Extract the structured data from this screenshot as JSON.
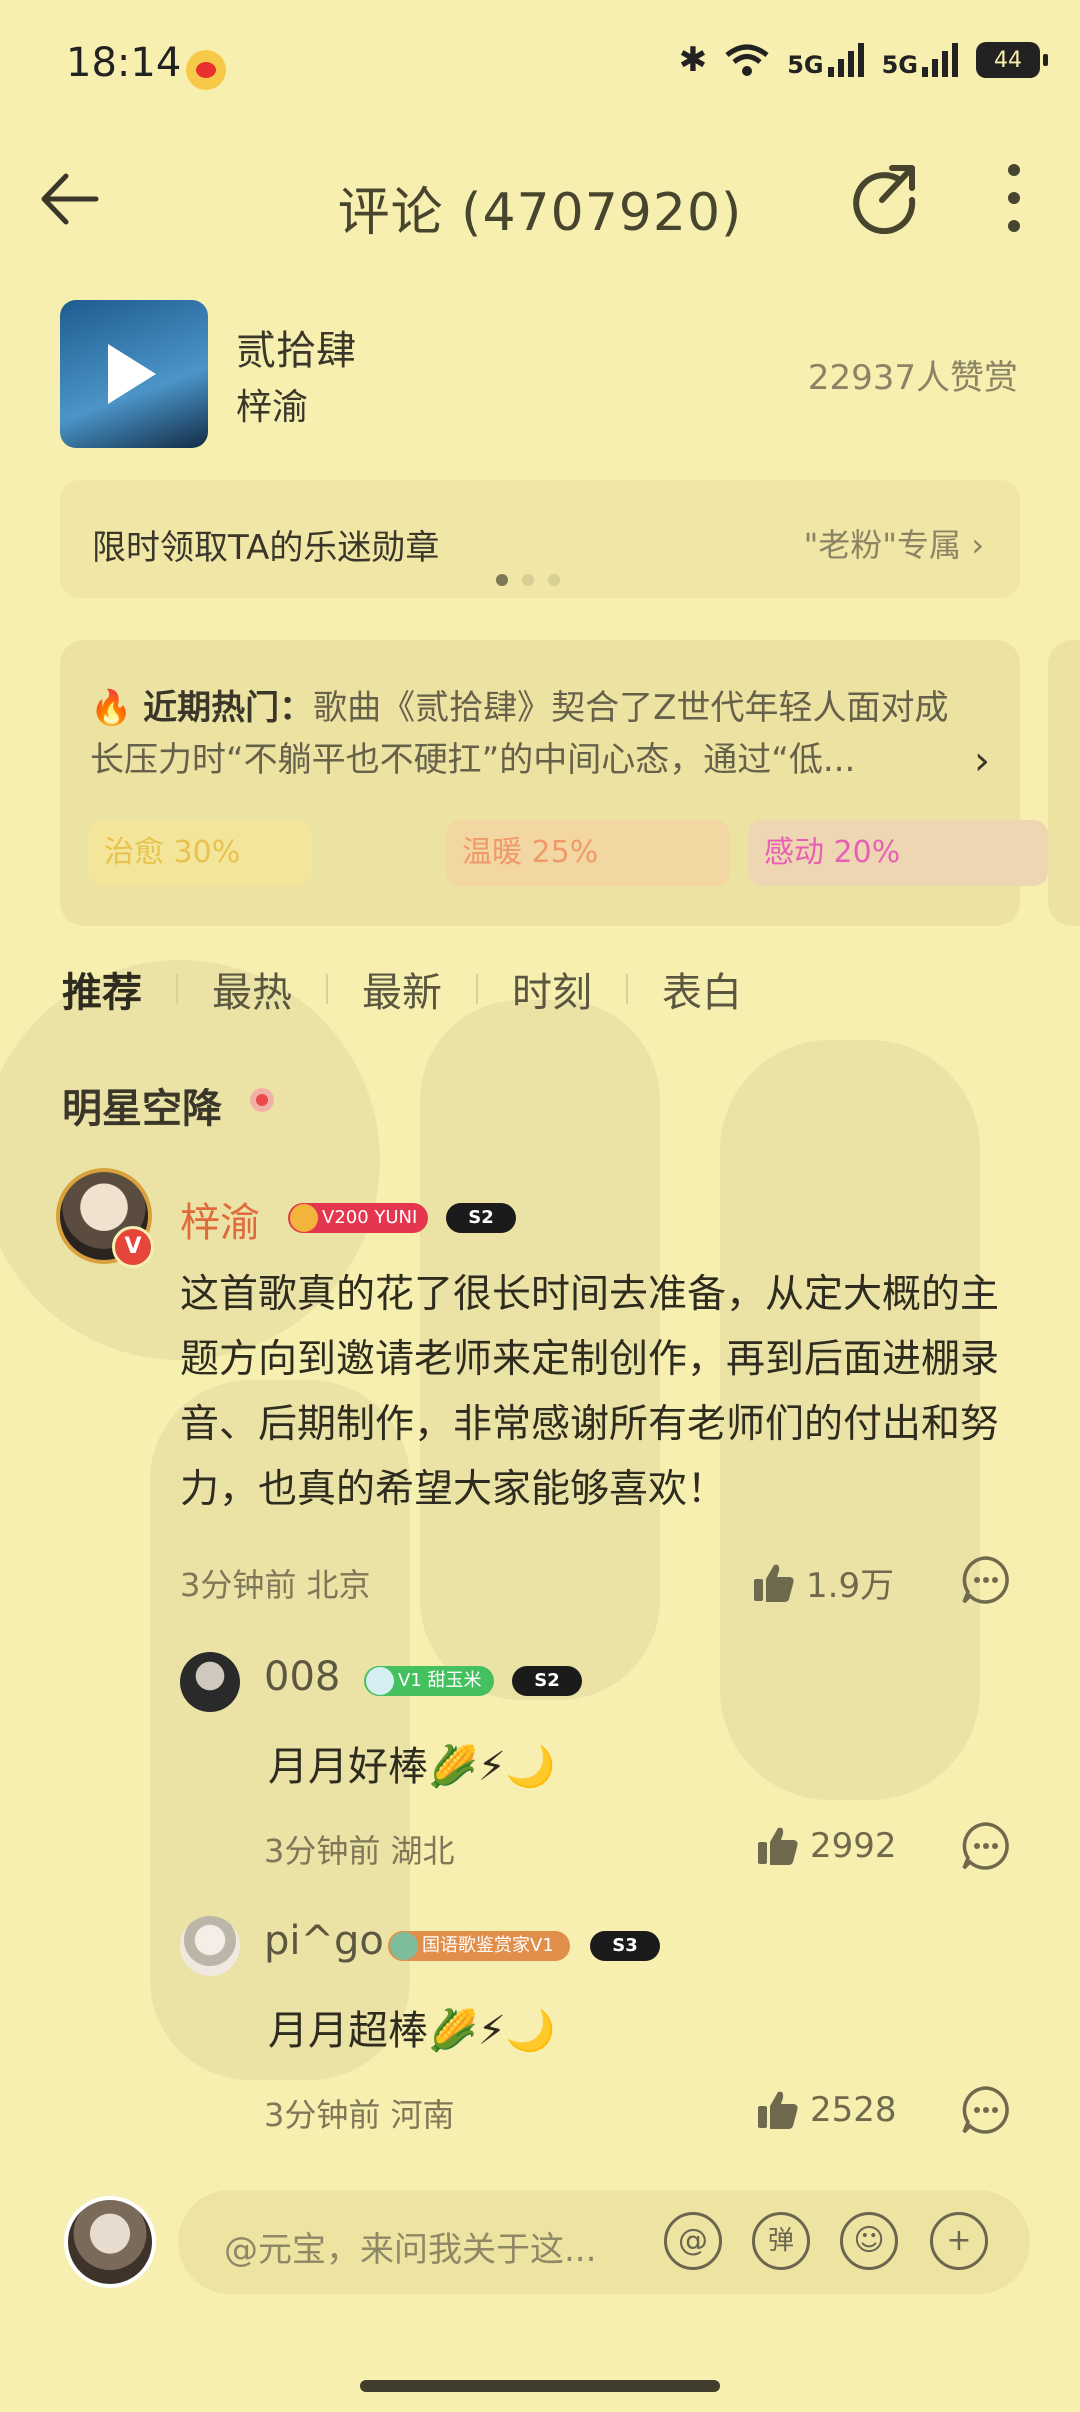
{
  "status_bar": {
    "time": "18:14",
    "signal1": "5G",
    "signal2": "5G",
    "battery": "44"
  },
  "header": {
    "title": "评论 (4707920)",
    "back_icon": "arrow-left-icon",
    "share_icon": "share-icon",
    "more_icon": "more-vertical-icon"
  },
  "song": {
    "title": "贰拾肆",
    "artist": "梓渝",
    "praise_count": "22937人赞赏"
  },
  "badge_banner": {
    "text": "限时领取TA的乐迷勋章",
    "action": "\"老粉\"专属 ›"
  },
  "hot_card": {
    "label": "近期热门：",
    "text": "歌曲《贰拾肆》契合了Z世代年轻人面对成长压力时“不躺平也不硬扛”的中间心态，通过“低...",
    "tags": [
      "治愈 30%",
      "温暖 25%",
      "感动 20%"
    ]
  },
  "tabs": [
    "推荐",
    "最热",
    "最新",
    "时刻",
    "表白"
  ],
  "section_title": "明星空降",
  "main_comment": {
    "author": "梓渝",
    "level_badge": "V200 YUNI",
    "season_badge": "S2",
    "text": "这首歌真的花了很长时间去准备，从定大概的主题方向到邀请老师来定制创作，再到后面进棚录音、后期制作，非常感谢所有老师们的付出和努力，也真的希望大家能够喜欢！",
    "meta": "3分钟前 北京",
    "likes": "1.9万"
  },
  "replies": [
    {
      "author": "008",
      "level_badge": "V1 甜玉米",
      "season_badge": "S2",
      "text": "月月好棒🌽⚡🌙",
      "meta": "3分钟前 湖北",
      "likes": "2992"
    },
    {
      "author": "pi^go",
      "level_badge": "国语歌鉴赏家V1",
      "season_badge": "S3",
      "text": "月月超棒🌽⚡🌙",
      "meta": "3分钟前 河南",
      "likes": "2528"
    }
  ],
  "input_bar": {
    "placeholder": "@元宝，来问我关于这...",
    "icons": [
      "at-icon",
      "danmaku-icon",
      "emoji-icon",
      "plus-icon"
    ],
    "danmaku_label": "弹"
  },
  "colors": {
    "background": "#f7efb0",
    "accent_name": "#e06a3c",
    "hot_flame": "#e85a1e"
  }
}
